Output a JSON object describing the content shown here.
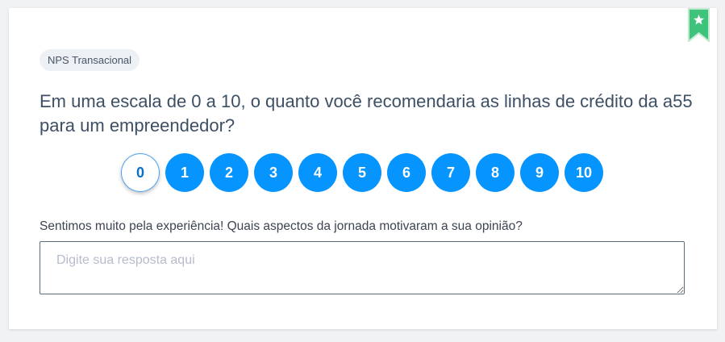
{
  "survey": {
    "tag": "NPS Transacional",
    "question": "Em uma escala de 0 a 10, o quanto você recomendaria as linhas de crédito da a55 para um empreendedor?",
    "scores": [
      "0",
      "1",
      "2",
      "3",
      "4",
      "5",
      "6",
      "7",
      "8",
      "9",
      "10"
    ],
    "selected_score": "0",
    "followup_question": "Sentimos muito pela experiência! Quais aspectos da jornada motivaram a sua opinião?",
    "answer_placeholder": "Digite sua resposta aqui",
    "answer_value": ""
  },
  "icons": {
    "bookmark": "star-bookmark-icon"
  },
  "colors": {
    "accent": "#0694ff",
    "bookmark": "#3ec47a",
    "text": "#3d4f64"
  }
}
